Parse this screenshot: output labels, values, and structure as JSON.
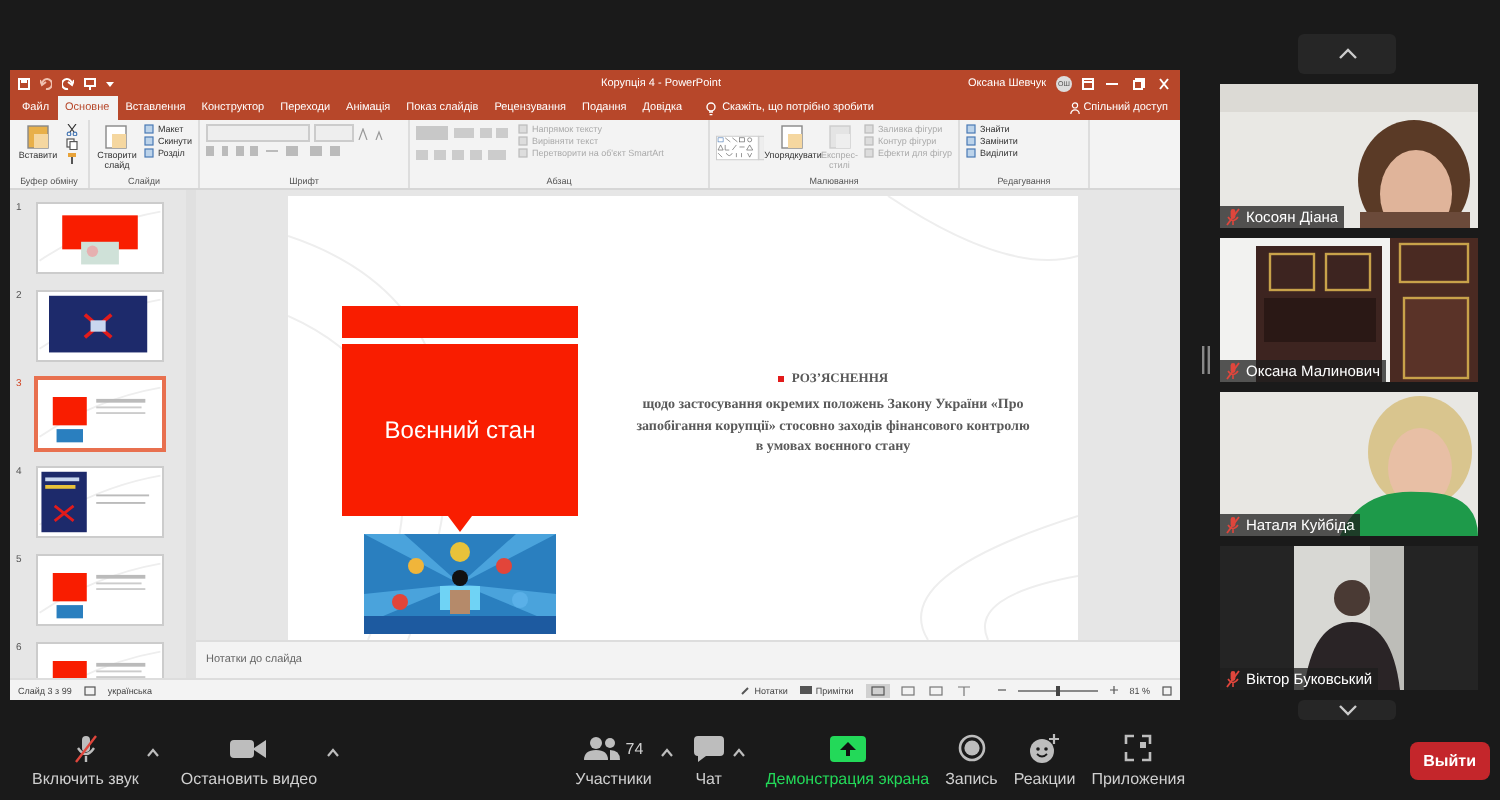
{
  "powerpoint": {
    "title": "Корупція 4 - PowerPoint",
    "user": "Оксана Шевчук",
    "avatar": "ОШ",
    "tabs": [
      {
        "label": "Файл",
        "selected": false
      },
      {
        "label": "Основне",
        "selected": true
      },
      {
        "label": "Вставлення",
        "selected": false
      },
      {
        "label": "Конструктор",
        "selected": false
      },
      {
        "label": "Переходи",
        "selected": false
      },
      {
        "label": "Анімація",
        "selected": false
      },
      {
        "label": "Показ слайдів",
        "selected": false
      },
      {
        "label": "Рецензування",
        "selected": false
      },
      {
        "label": "Подання",
        "selected": false
      },
      {
        "label": "Довідка",
        "selected": false
      }
    ],
    "search": "Скажіть, що потрібно зробити",
    "share": "Спільний доступ",
    "ribbon": [
      {
        "label": "Буфер обміну",
        "kind": "clipboard",
        "large": [
          {
            "text": "Вставити",
            "disabled": false
          }
        ]
      },
      {
        "label": "Слайди",
        "kind": "slides",
        "large": [
          {
            "text": "Створити слайд",
            "disabled": false
          }
        ],
        "small": [
          {
            "text": "Макет",
            "disabled": false
          },
          {
            "text": "Скинути",
            "disabled": false
          },
          {
            "text": "Розділ",
            "disabled": false
          }
        ]
      },
      {
        "label": "Шрифт",
        "kind": "font"
      },
      {
        "label": "Абзац",
        "kind": "paragraph",
        "small": [
          {
            "text": "Напрямок тексту",
            "disabled": true
          },
          {
            "text": "Вирівняти текст",
            "disabled": true
          },
          {
            "text": "Перетворити на об'єкт SmartArt",
            "disabled": true
          }
        ]
      },
      {
        "label": "Малювання",
        "kind": "drawing",
        "large": [
          {
            "text": "Упорядкувати",
            "disabled": false
          },
          {
            "text": "Експрес-стилі",
            "disabled": true
          }
        ],
        "small": [
          {
            "text": "Заливка фігури",
            "disabled": true
          },
          {
            "text": "Контур фігури",
            "disabled": true
          },
          {
            "text": "Ефекти для фігур",
            "disabled": true
          }
        ]
      },
      {
        "label": "Редагування",
        "kind": "editing",
        "small": [
          {
            "text": "Знайти",
            "disabled": false
          },
          {
            "text": "Замінити",
            "disabled": false
          },
          {
            "text": "Виділити",
            "disabled": false
          }
        ]
      }
    ],
    "thumbnails": [
      {
        "number": "1",
        "kind": "red-photo",
        "selected": false
      },
      {
        "number": "2",
        "kind": "navy",
        "selected": false
      },
      {
        "number": "3",
        "kind": "red-text",
        "selected": true
      },
      {
        "number": "4",
        "kind": "navy-text",
        "selected": false
      },
      {
        "number": "5",
        "kind": "red-text",
        "selected": false
      },
      {
        "number": "6",
        "kind": "red-text",
        "selected": false
      }
    ],
    "slide": {
      "title": "Воєнний стан",
      "heading": "РОЗ’ЯСНЕННЯ",
      "body": "щодо застосування окремих положень Закону України «Про запобігання корупції» стосовно заходів фінансового контролю в умовах воєнного стану"
    },
    "notes_placeholder": "Нотатки до слайда",
    "status_bar": {
      "slide": "Слайд 3 з 99",
      "language": "українська",
      "notes": "Нотатки",
      "comments": "Примітки",
      "zoom": {
        "level": 0.5,
        "reading": "81 %"
      }
    }
  },
  "participants": [
    {
      "name": "Косоян Діана",
      "muted": true,
      "kind": "woman"
    },
    {
      "name": "Оксана Малинович",
      "muted": true,
      "kind": "cabinet"
    },
    {
      "name": "Наталя Куйбіда",
      "muted": true,
      "kind": "blonde"
    },
    {
      "name": "Віктор Буковський",
      "muted": true,
      "kind": "man"
    }
  ],
  "toolbar": {
    "items": [
      {
        "kind": "audio",
        "label": "Включить звук",
        "muted": true,
        "menu": true
      },
      {
        "kind": "video",
        "label": "Остановить видео",
        "menu": true
      },
      {
        "kind": "participants",
        "label": "Участники",
        "count": "74",
        "menu": true
      },
      {
        "kind": "chat",
        "label": "Чат",
        "menu": true
      },
      {
        "kind": "share",
        "label": "Демонстрация экрана"
      },
      {
        "kind": "record",
        "label": "Запись"
      },
      {
        "kind": "reactions",
        "label": "Реакции"
      },
      {
        "kind": "apps",
        "label": "Приложения"
      }
    ],
    "leave": "Выйти"
  }
}
